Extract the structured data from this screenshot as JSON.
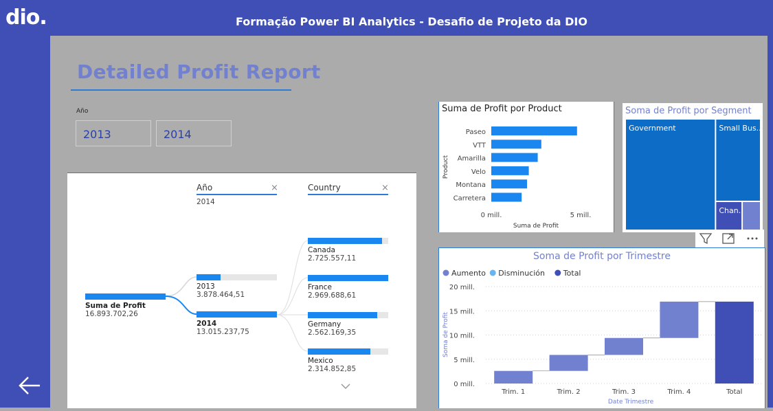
{
  "app": {
    "logo": "dio.",
    "title": "Formação Power BI Analytics - Desafio de Projeto da DIO"
  },
  "report": {
    "title": "Detailed Profit Report"
  },
  "slicer": {
    "label": "Año",
    "options": [
      "2013",
      "2014"
    ]
  },
  "decomposition": {
    "root": {
      "label": "Suma de Profit",
      "value": "16.893.702,26",
      "fill": 1.0
    },
    "levels": [
      {
        "header": "Año",
        "selected": "2014"
      },
      {
        "header": "Country",
        "selected": ""
      }
    ],
    "years": [
      {
        "label": "2013",
        "value": "3.878.464,51",
        "fill": 0.3
      },
      {
        "label": "2014",
        "value": "13.015.237,75",
        "fill": 1.0
      }
    ],
    "countries": [
      {
        "label": "Canada",
        "value": "2.725.557,11",
        "fill": 0.92
      },
      {
        "label": "France",
        "value": "2.969.688,61",
        "fill": 1.0
      },
      {
        "label": "Germany",
        "value": "2.562.169,35",
        "fill": 0.86
      },
      {
        "label": "Mexico",
        "value": "2.314.852,85",
        "fill": 0.78
      }
    ],
    "close_symbol": "×",
    "more_symbol": "⌄"
  },
  "chart_data": [
    {
      "type": "bar",
      "title": "Suma de Profit por Product",
      "xlabel": "Suma de Profit",
      "ylabel": "Product",
      "categories": [
        "Paseo",
        "VTT",
        "Amarilla",
        "Velo",
        "Montana",
        "Carretera"
      ],
      "values": [
        4.8,
        2.8,
        2.6,
        2.1,
        2.0,
        1.7
      ],
      "unit": "mill.",
      "xlim": [
        0,
        5
      ],
      "tick_labels": [
        "0 mill.",
        "5 mill."
      ],
      "color": "#1a87f0"
    },
    {
      "type": "treemap",
      "title": "Soma de Profit por Segment",
      "categories": [
        "Government",
        "Small Bus...",
        "Chan...",
        ""
      ],
      "values": [
        11.39,
        4.14,
        0.84,
        0.54
      ],
      "colors": [
        "#0d6cc5",
        "#0d6cc5",
        "#3f4fb5",
        "#7280d0"
      ]
    },
    {
      "type": "waterfall",
      "title": "Soma de Profit por Trimestre",
      "xlabel": "Date Trimestre",
      "ylabel": "Soma de Profit",
      "categories": [
        "Trim. 1",
        "Trim. 2",
        "Trim. 3",
        "Trim. 4",
        "Total"
      ],
      "values": [
        2.6,
        3.3,
        3.5,
        7.5,
        16.9
      ],
      "ylim": [
        0,
        20
      ],
      "tick_labels": [
        "0 mill.",
        "5 mill.",
        "10 mill.",
        "15 mill.",
        "20 mill."
      ],
      "legend": [
        {
          "name": "Aumento",
          "color": "#7280d0"
        },
        {
          "name": "Disminución",
          "color": "#67b4f0"
        },
        {
          "name": "Total",
          "color": "#3f4fb5"
        }
      ]
    }
  ],
  "visual_header_icons": [
    "filter-icon",
    "focus-mode-icon",
    "more-options-icon"
  ]
}
